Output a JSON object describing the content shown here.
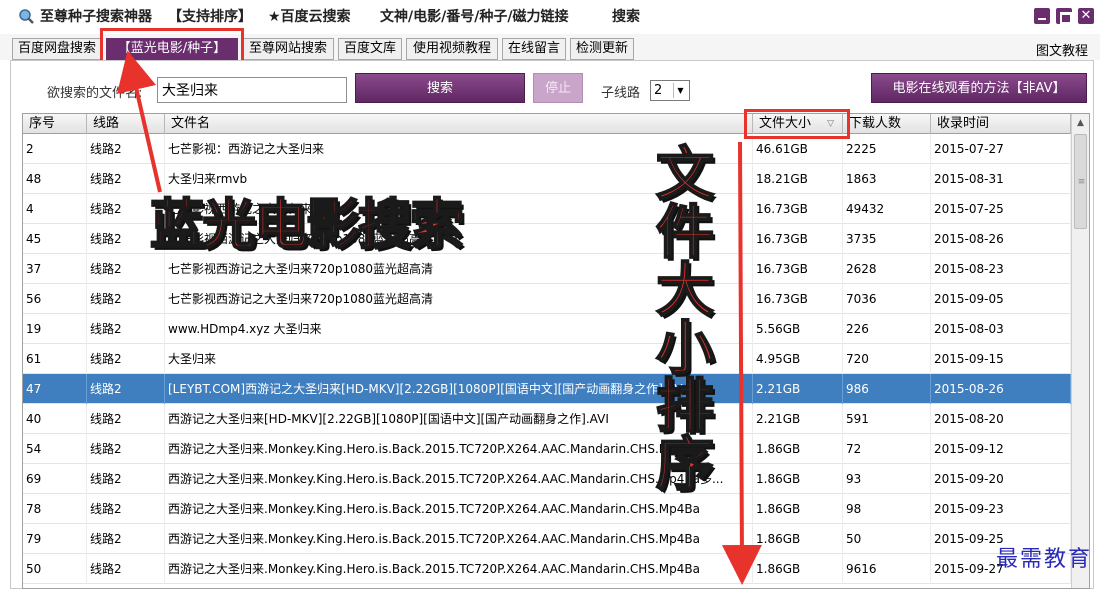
{
  "titlebar": {
    "items": [
      "至尊种子搜索神器",
      "【支持排序】",
      "★百度云搜索",
      "文神/电影/番号/种子/磁力链接",
      "搜索"
    ]
  },
  "tabs": [
    {
      "label": "百度网盘搜索",
      "active": false
    },
    {
      "label": "【蓝光电影/种子】",
      "active": true
    },
    {
      "label": "至尊网站搜索",
      "active": false
    },
    {
      "label": "百度文库",
      "active": false
    },
    {
      "label": "使用视频教程",
      "active": false
    },
    {
      "label": "在线留言",
      "active": false
    },
    {
      "label": "检测更新",
      "active": false
    }
  ],
  "tab_help": "图文教程",
  "search": {
    "label": "欲搜索的文件名:",
    "value": "大圣归来",
    "search_button": "搜索",
    "stop_button": "停止",
    "thread_label": "子线路",
    "thread_value": "2",
    "movie_button": "电影在线观看的方法【非AV】"
  },
  "table": {
    "columns": [
      "序号",
      "线路",
      "文件名",
      "文件大小",
      "下载人数",
      "收录时间"
    ],
    "rows": [
      [
        "2",
        "线路2",
        "七芒影视：西游记之大圣归来",
        "46.61GB",
        "2225",
        "2015-07-27"
      ],
      [
        "48",
        "线路2",
        "大圣归来rmvb",
        "18.21GB",
        "1863",
        "2015-08-31"
      ],
      [
        "4",
        "线路2",
        "七芒影视西游记之大圣归来",
        "16.73GB",
        "49432",
        "2015-07-25"
      ],
      [
        "45",
        "线路2",
        "七芒影视西游记之大圣归来720p1080蓝光超高清",
        "16.73GB",
        "3735",
        "2015-08-26"
      ],
      [
        "37",
        "线路2",
        "七芒影视西游记之大圣归来720p1080蓝光超高清",
        "16.73GB",
        "2628",
        "2015-08-23"
      ],
      [
        "56",
        "线路2",
        "七芒影视西游记之大圣归来720p1080蓝光超高清",
        "16.73GB",
        "7036",
        "2015-09-05"
      ],
      [
        "19",
        "线路2",
        "www.HDmp4.xyz 大圣归来",
        "5.56GB",
        "226",
        "2015-08-03"
      ],
      [
        "61",
        "线路2",
        "大圣归来",
        "4.95GB",
        "720",
        "2015-09-15"
      ],
      [
        "47",
        "线路2",
        "[LEYBT.COM]西游记之大圣归来[HD-MKV][2.22GB][1080P][国语中文][国产动画翻身之作].AV",
        "2.21GB",
        "986",
        "2015-08-26"
      ],
      [
        "40",
        "线路2",
        "西游记之大圣归来[HD-MKV][2.22GB][1080P][国语中文][国产动画翻身之作].AVI",
        "2.21GB",
        "591",
        "2015-08-20"
      ],
      [
        "54",
        "线路2",
        "西游记之大圣归来.Monkey.King.Hero.is.Back.2015.TC720P.X264.AAC.Mandarin.CHS.Mp4Ba",
        "1.86GB",
        "72",
        "2015-09-12"
      ],
      [
        "69",
        "线路2",
        "西游记之大圣归来.Monkey.King.Hero.is.Back.2015.TC720P.X264.AAC.Mandarin.CHS.Mp4Ba多...",
        "1.86GB",
        "93",
        "2015-09-20"
      ],
      [
        "78",
        "线路2",
        "西游记之大圣归来.Monkey.King.Hero.is.Back.2015.TC720P.X264.AAC.Mandarin.CHS.Mp4Ba",
        "1.86GB",
        "98",
        "2015-09-23"
      ],
      [
        "79",
        "线路2",
        "西游记之大圣归来.Monkey.King.Hero.is.Back.2015.TC720P.X264.AAC.Mandarin.CHS.Mp4Ba",
        "1.86GB",
        "50",
        "2015-09-25"
      ],
      [
        "50",
        "线路2",
        "西游记之大圣归来.Monkey.King.Hero.is.Back.2015.TC720P.X264.AAC.Mandarin.CHS.Mp4Ba",
        "1.86GB",
        "9616",
        "2015-09-27"
      ]
    ],
    "selected_row": 8
  },
  "annotations": {
    "horizontal": "蓝光电影搜索",
    "vertical": "文件大小排序",
    "watermark": "最需教育"
  },
  "colors": {
    "accent": "#6a2d6e",
    "selection": "#3f7fbf",
    "annotation": "#e8322c"
  }
}
